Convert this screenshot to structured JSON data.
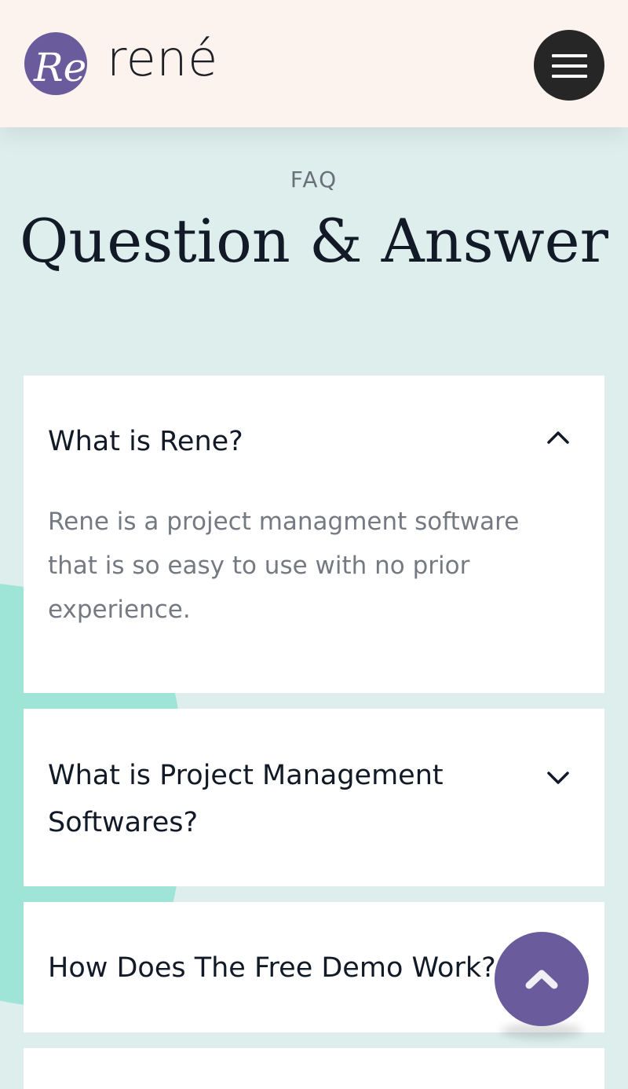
{
  "brand": {
    "name": "rené",
    "logo_letters": "Re"
  },
  "header": {
    "menu_icon": "hamburger-icon"
  },
  "section": {
    "eyebrow": "FAQ",
    "title": "Question & Answer"
  },
  "faq": [
    {
      "question": "What is Rene?",
      "answer": "Rene is a project managment software that is so easy to use with no prior experience.",
      "expanded": true
    },
    {
      "question": "What is Project Management Softwares?",
      "expanded": false
    },
    {
      "question": "How Does The Free Demo Work?",
      "expanded": false
    }
  ],
  "scroll_top": {
    "icon": "chevron-up-icon"
  },
  "colors": {
    "accent": "#6a5b9c",
    "header_bg": "#fcf2ee",
    "page_bg": "#ddeeec",
    "blob": "#9ee5d8"
  }
}
